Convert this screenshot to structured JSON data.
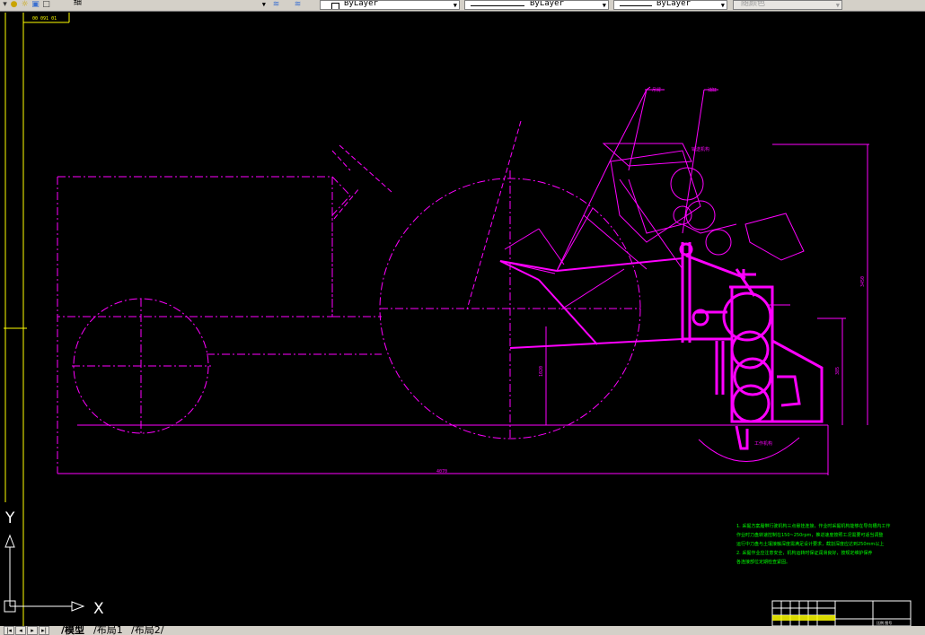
{
  "toolbar": {
    "lineweight_label": "细",
    "layer_color": "ByLayer",
    "linetype": "ByLayer",
    "lineweight": "ByLayer",
    "plot_style": "随颜色"
  },
  "drawing": {
    "top_label": "00 091 01",
    "dim_length": "4070",
    "dim_height_left": "1020",
    "dim_height_right": "3450",
    "dim_small": "385",
    "note_callout_1": "吊臂",
    "note_callout_2": "油缸",
    "note_callout_3": "输送机构",
    "note_callout_4": "工作机构",
    "tech_notes": [
      "1. 采掘方案履带行驶机构三点悬挂连接，作业时采掘机构能够在导向槽内工作",
      "作业时刀盘转速控制在150~250rpm，推进速度按照工况需要可适当调整",
      "运行中刀盘与土壤接触深度需满足设计要求，截割深度应达到250mm以上",
      "2. 采掘作业应注意安全，机构运转时保证润滑良好，按规定维护保养",
      "各连接部位定期检查紧固。"
    ],
    "title_block_text": "比例 图号"
  },
  "ucs": {
    "y_label": "Y",
    "x_label": "X"
  },
  "tabs": {
    "nav_first": "|◂",
    "nav_prev": "◂",
    "nav_next": "▸",
    "nav_last": "▸|",
    "model": "模型",
    "layout1": "布局1",
    "layout2": "布局2"
  },
  "colors": {
    "background": "#000000",
    "geometry": "#ff00ff",
    "text_notes": "#00ff00",
    "frame": "#ffff00",
    "ucs": "#ffffff"
  }
}
